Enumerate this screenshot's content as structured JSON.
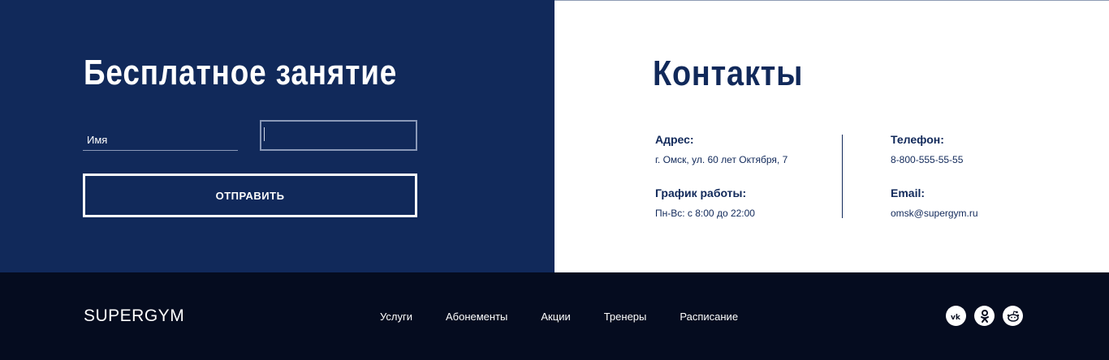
{
  "free_session": {
    "title": "Бесплатное занятие",
    "name_placeholder": "Имя",
    "phone_value": "",
    "submit_label": "ОТПРАВИТЬ"
  },
  "contacts": {
    "title": "Контакты",
    "address_label": "Адрес:",
    "address_value": "г. Омск, ул. 60 лет Октября, 7",
    "hours_label": "График работы:",
    "hours_value": "Пн-Вс: с 8:00 до 22:00",
    "phone_label": "Телефон:",
    "phone_value": "8-800-555-55-55",
    "email_label": "Email:",
    "email_value": "omsk@supergym.ru"
  },
  "footer": {
    "logo": "SUPERGYM",
    "nav": [
      "Услуги",
      "Абонементы",
      "Акции",
      "Тренеры",
      "Расписание"
    ],
    "socials": [
      {
        "icon": "vk-icon",
        "glyph": "vk"
      },
      {
        "icon": "odnoklassniki-icon",
        "glyph": "ok"
      },
      {
        "icon": "reddit-icon",
        "glyph": "rd"
      }
    ]
  },
  "colors": {
    "primary_blue": "#11295a",
    "footer_bg": "#050c1f",
    "white": "#ffffff"
  }
}
